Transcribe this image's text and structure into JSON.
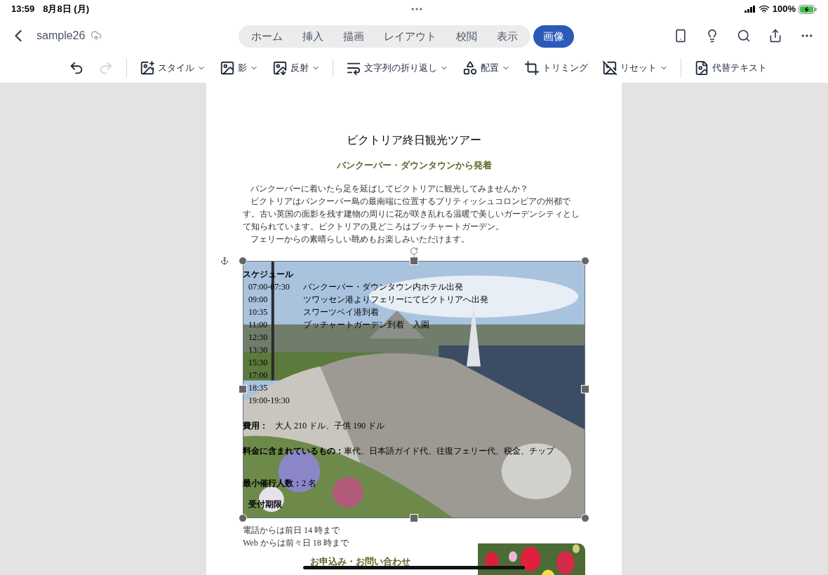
{
  "status_bar": {
    "time": "13:59",
    "date": "8月8日 (月)",
    "battery": "100%"
  },
  "title_bar": {
    "file_name": "sample26"
  },
  "tabs": [
    {
      "label": "ホーム",
      "selected": false
    },
    {
      "label": "挿入",
      "selected": false
    },
    {
      "label": "描画",
      "selected": false
    },
    {
      "label": "レイアウト",
      "selected": false
    },
    {
      "label": "校閲",
      "selected": false
    },
    {
      "label": "表示",
      "selected": false
    },
    {
      "label": "画像",
      "selected": true
    }
  ],
  "ribbon": [
    {
      "kind": "undo"
    },
    {
      "kind": "redo",
      "disabled": true
    },
    {
      "kind": "style",
      "label": "スタイル",
      "dropdown": true
    },
    {
      "kind": "shadow",
      "label": "影",
      "dropdown": true
    },
    {
      "kind": "reflection",
      "label": "反射",
      "dropdown": true
    },
    {
      "kind": "wrap",
      "label": "文字列の折り返し",
      "dropdown": true
    },
    {
      "kind": "arrange",
      "label": "配置",
      "dropdown": true
    },
    {
      "kind": "crop",
      "label": "トリミング",
      "dropdown": false
    },
    {
      "kind": "reset",
      "label": "リセット",
      "dropdown": true
    },
    {
      "kind": "alt",
      "label": "代替テキスト",
      "dropdown": false
    }
  ],
  "document": {
    "title": "ビクトリア終日観光ツアー",
    "subtitle": "バンクーバー・ダウンタウンから発着",
    "paragraphs": [
      "バンクーバーに着いたら足を延ばしてビクトリアに観光してみませんか？",
      "ビクトリアはバンクーバー島の最南端に位置するブリティッシュコロンビアの州都です。古い英国の面影を残す建物の周りに花が咲き乱れる温暖で美しいガーデンシティとして知られています。ビクトリアの見どころはブッチャートガーデン。",
      "フェリーからの素晴らしい眺めもお楽しみいただけます。"
    ],
    "schedule_heading": "スケジュール",
    "schedule": [
      {
        "time": "07:00-07:30",
        "activity": "バンクーバー・ダウンタウン内ホテル出発"
      },
      {
        "time": "09:00",
        "activity": "ツワッセン港よりフェリーにてビクトリアへ出発"
      },
      {
        "time": "10:35",
        "activity": "スワーツベイ港到着"
      },
      {
        "time": "11:00",
        "activity": "ブッチャートガーデン到着　入園"
      },
      {
        "time": "12:30"
      },
      {
        "time": "13:30"
      },
      {
        "time": "15:30"
      },
      {
        "time": "17:00"
      },
      {
        "time": "18:35"
      },
      {
        "time": "19:00-19:30"
      }
    ],
    "fee_label": "費用：",
    "fee": "大人 210 ドル、子供 190 ドル",
    "included_label": "料金に含まれているもの：",
    "included": "車代、日本語ガイド代、往復フェリー代、税金、チップ",
    "minimum_label": "最小催行人数：",
    "minimum": "2 名",
    "deadline_label": "受付期限",
    "deadline_lines": [
      "電話からは前日 14 時まで",
      "Web からは前々日 18 時まで"
    ],
    "contact_heading": "お申込み・お問い合わせ"
  }
}
